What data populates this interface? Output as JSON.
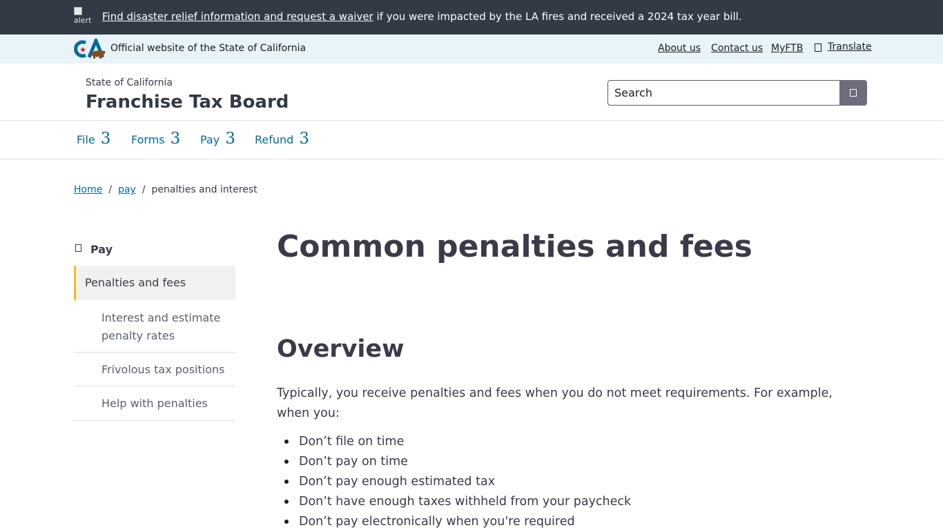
{
  "alert": {
    "icon_alt": "alert",
    "link_text": "Find disaster relief information and request a waiver",
    "rest_text": " if you were impacted by the LA fires and received a 2024 tax year bill."
  },
  "official_bar": {
    "text": "Official website of the State of California",
    "links": {
      "about": "About us",
      "contact": "Contact us",
      "myftb": "MyFTB",
      "translate": "Translate"
    }
  },
  "header": {
    "org_top": "State of California",
    "org_name": "Franchise Tax Board",
    "search_placeholder": "Search"
  },
  "main_nav": [
    {
      "label": "File",
      "chevron": "3"
    },
    {
      "label": "Forms",
      "chevron": "3"
    },
    {
      "label": "Pay",
      "chevron": "3"
    },
    {
      "label": "Refund",
      "chevron": "3"
    }
  ],
  "breadcrumb": {
    "home": "Home",
    "pay": "pay",
    "current": "penalties and interest",
    "separator": "/"
  },
  "side_nav": {
    "heading": "Pay",
    "active": "Penalties and fees",
    "items": [
      "Interest and estimate penalty rates",
      "Frivolous tax positions",
      "Help with penalties"
    ]
  },
  "content": {
    "title": "Common penalties and fees",
    "overview_heading": "Overview",
    "intro": "Typically, you receive penalties and fees when you do not meet requirements. For example, when you:",
    "bullets": [
      "Don’t file on time",
      "Don’t pay on time",
      "Don’t pay enough estimated tax",
      "Don’t have enough taxes withheld from your paycheck",
      "Don’t pay electronically when you're required"
    ]
  },
  "colors": {
    "alert_bg": "#323a45",
    "official_bg": "#e8f3fa",
    "link_blue": "#046b99",
    "active_accent": "#fdb81e",
    "search_button": "#6c6c7c"
  }
}
